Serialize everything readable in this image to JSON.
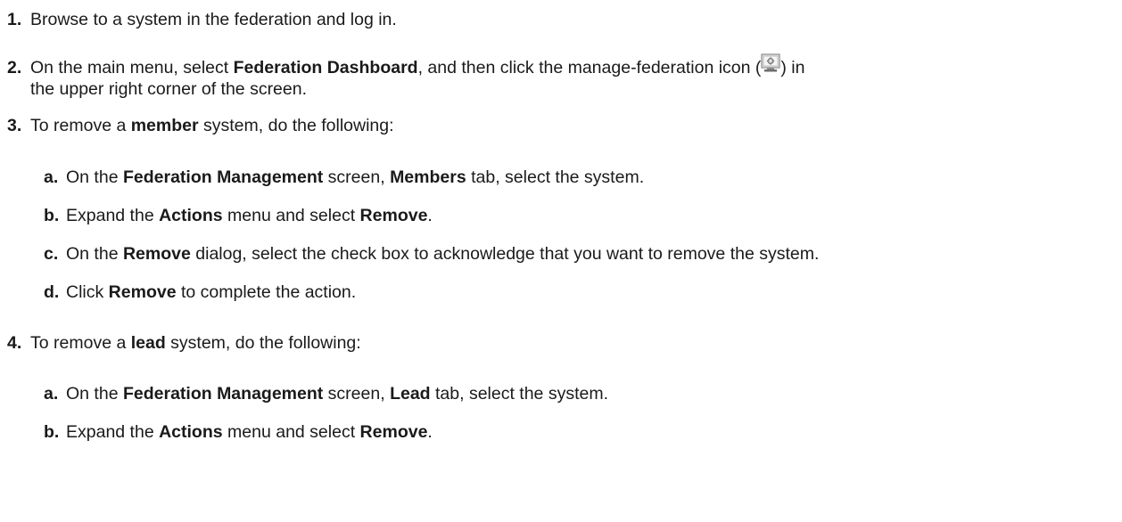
{
  "steps": [
    {
      "num": "1.",
      "text": "Browse to a system in the federation and log in."
    },
    {
      "num": "2.",
      "p1": "On the main menu, select ",
      "b1": "Federation Dashboard",
      "p2": ", and then click the manage-federation icon (",
      "icon": "manage-federation-icon",
      "p3": ") in",
      "line2": "the upper right corner of the screen."
    },
    {
      "num": "3.",
      "p1": "To remove a ",
      "b1": "member",
      "p2": " system, do the following:",
      "sub": [
        {
          "letter": "a.",
          "p1": "On the ",
          "b1": "Federation Management",
          "p2": " screen, ",
          "b2": "Members",
          "p3": " tab, select the system."
        },
        {
          "letter": "b.",
          "p1": "Expand the ",
          "b1": "Actions",
          "p2": " menu and select ",
          "b2": "Remove",
          "p3": "."
        },
        {
          "letter": "c.",
          "p1": "On the ",
          "b1": "Remove",
          "p2": " dialog, select the check box to acknowledge that you want to remove the system."
        },
        {
          "letter": "d.",
          "p1": "Click ",
          "b1": "Remove",
          "p2": " to complete the action."
        }
      ]
    },
    {
      "num": "4.",
      "p1": "To remove a ",
      "b1": "lead",
      "p2": " system, do the following:",
      "sub": [
        {
          "letter": "a.",
          "p1": "On the ",
          "b1": "Federation Management",
          "p2": " screen, ",
          "b2": "Lead",
          "p3": " tab, select the system."
        },
        {
          "letter": "b.",
          "p1": "Expand the ",
          "b1": "Actions",
          "p2": " menu and select ",
          "b2": "Remove",
          "p3": "."
        }
      ]
    }
  ]
}
